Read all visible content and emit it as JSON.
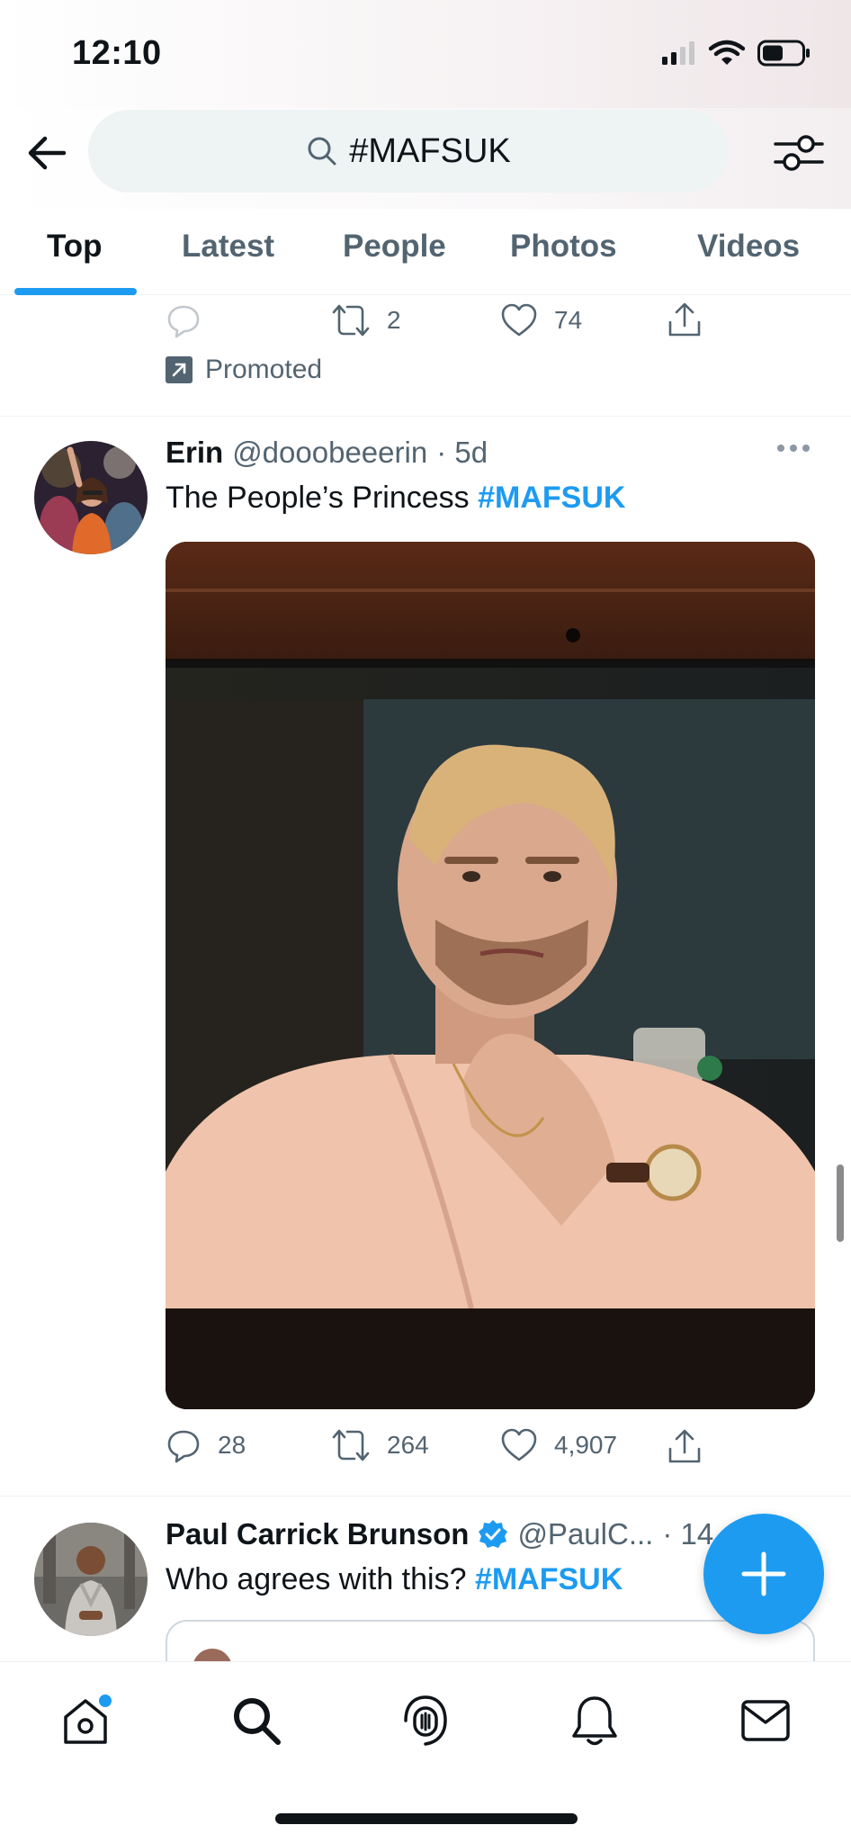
{
  "status_bar": {
    "time": "12:10"
  },
  "search": {
    "query": "#MAFSUK"
  },
  "tabs": [
    {
      "label": "Top"
    },
    {
      "label": "Latest"
    },
    {
      "label": "People"
    },
    {
      "label": "Photos"
    },
    {
      "label": "Videos"
    }
  ],
  "previous_tweet": {
    "reply_count": "",
    "retweet_count": "2",
    "like_count": "74",
    "promoted_label": "Promoted"
  },
  "tweet1": {
    "name": "Erin",
    "handle": "@dooobeeerin",
    "time": "· 5d",
    "text": "The People’s Princess ",
    "hashtag": "#MAFSUK",
    "reply_count": "28",
    "retweet_count": "264",
    "like_count": "4,907"
  },
  "tweet2": {
    "name": "Paul Carrick Brunson",
    "verified": true,
    "handle": "@PaulC...",
    "time": "· 14",
    "text": "Who agrees with this? ",
    "hashtag": "#MAFSUK"
  },
  "colors": {
    "accent": "#1d9bf0",
    "text_primary": "#0f1419",
    "text_secondary": "#536471"
  },
  "icons": {
    "back": "arrow-left-icon",
    "search": "search-icon",
    "filter": "filter-sliders-icon",
    "reply": "reply-icon",
    "retweet": "retweet-icon",
    "like": "heart-icon",
    "share": "share-icon",
    "compose": "plus-icon",
    "home": "home-icon",
    "explore": "search-icon",
    "spaces": "spaces-icon",
    "notifications": "bell-icon",
    "messages": "mail-icon"
  }
}
